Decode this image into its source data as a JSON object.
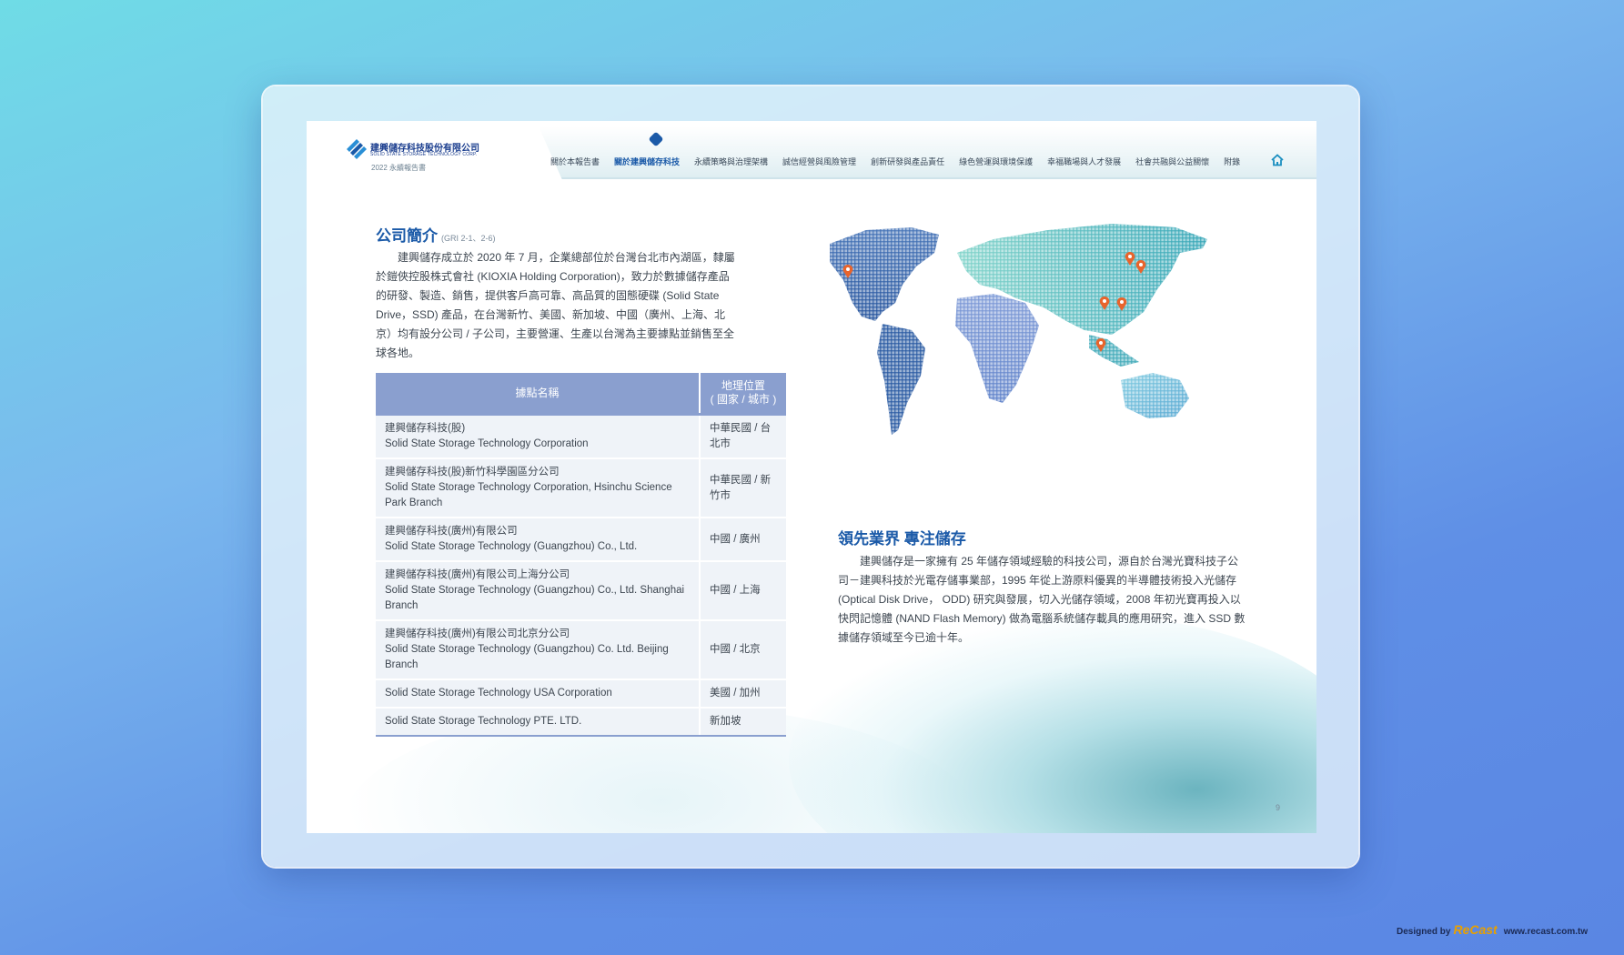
{
  "header": {
    "company_cn": "建興儲存科技股份有限公司",
    "company_en": "SOLID STATE STORAGE TECHNOLOGY CORP.",
    "report_title": "2022 永續報告書",
    "nav": [
      {
        "label": "關於本報告書",
        "active": false
      },
      {
        "label": "關於建興儲存科技",
        "active": true
      },
      {
        "label": "永續策略與治理架構",
        "active": false
      },
      {
        "label": "誠信經營與風險管理",
        "active": false
      },
      {
        "label": "創新研發與產品責任",
        "active": false
      },
      {
        "label": "綠色營運與環境保護",
        "active": false
      },
      {
        "label": "幸福職場與人才發展",
        "active": false
      },
      {
        "label": "社會共融與公益關懷",
        "active": false
      },
      {
        "label": "附錄",
        "active": false
      }
    ]
  },
  "intro": {
    "title": "公司簡介",
    "title_ref": "(GRI 2-1、2-6)",
    "body": "建興儲存成立於 2020 年 7 月，企業總部位於台灣台北市內湖區，隸屬於鎧俠控股株式會社 (KIOXIA Holding Corporation)，致力於數據儲存產品的研發、製造、銷售，提供客戶高可靠、高品質的固態硬碟 (Solid State Drive，SSD) 產品，在台灣新竹、美國、新加坡、中國（廣州、上海、北京）均有設分公司 / 子公司，主要營運、生產以台灣為主要據點並銷售至全球各地。"
  },
  "sites_table": {
    "headers": [
      "據點名稱",
      "地理位置\n( 國家 / 城市 )"
    ],
    "rows": [
      {
        "name_cn": "建興儲存科技(股)",
        "name_en": "Solid State Storage Technology Corporation",
        "location": "中華民國 / 台北市"
      },
      {
        "name_cn": "建興儲存科技(股)新竹科學園區分公司",
        "name_en": "Solid State Storage Technology Corporation, Hsinchu Science Park Branch",
        "location": "中華民國 / 新竹市"
      },
      {
        "name_cn": "建興儲存科技(廣州)有限公司",
        "name_en": "Solid State Storage Technology (Guangzhou) Co., Ltd.",
        "location": "中國 / 廣州"
      },
      {
        "name_cn": "建興儲存科技(廣州)有限公司上海分公司",
        "name_en": "Solid State Storage Technology  (Guangzhou) Co., Ltd. Shanghai Branch",
        "location": "中國 / 上海"
      },
      {
        "name_cn": "建興儲存科技(廣州)有限公司北京分公司",
        "name_en": "Solid State Storage Technology (Guangzhou) Co.  Ltd. Beijing Branch",
        "location": "中國 / 北京"
      },
      {
        "name_cn": "",
        "name_en": "Solid State Storage Technology USA Corporation",
        "location": "美國 / 加州"
      },
      {
        "name_cn": "",
        "name_en": "Solid State Storage Technology PTE. LTD.",
        "location": "新加坡"
      }
    ]
  },
  "leading": {
    "title": "領先業界 專注儲存",
    "body": "建興儲存是一家擁有 25 年儲存領域經驗的科技公司，源自於台灣光寶科技子公司－建興科技於光電存儲事業部，1995 年從上游原料優異的半導體技術投入光儲存 (Optical Disk Drive， ODD) 研究與發展，切入光儲存領域，2008 年初光寶再投入以快閃記憶體 (NAND Flash Memory) 做為電腦系統儲存載具的應用研究，進入 SSD 數據儲存領域至今已逾十年。"
  },
  "page_number": "9",
  "credit": {
    "prefix": "Designed by",
    "brand": "ReCast",
    "url": "www.recast.com.tw"
  },
  "colors": {
    "accent": "#1b5aa8",
    "table_header": "#8a9fcf",
    "table_row": "#eff3f8",
    "marker": "#e8642c"
  }
}
